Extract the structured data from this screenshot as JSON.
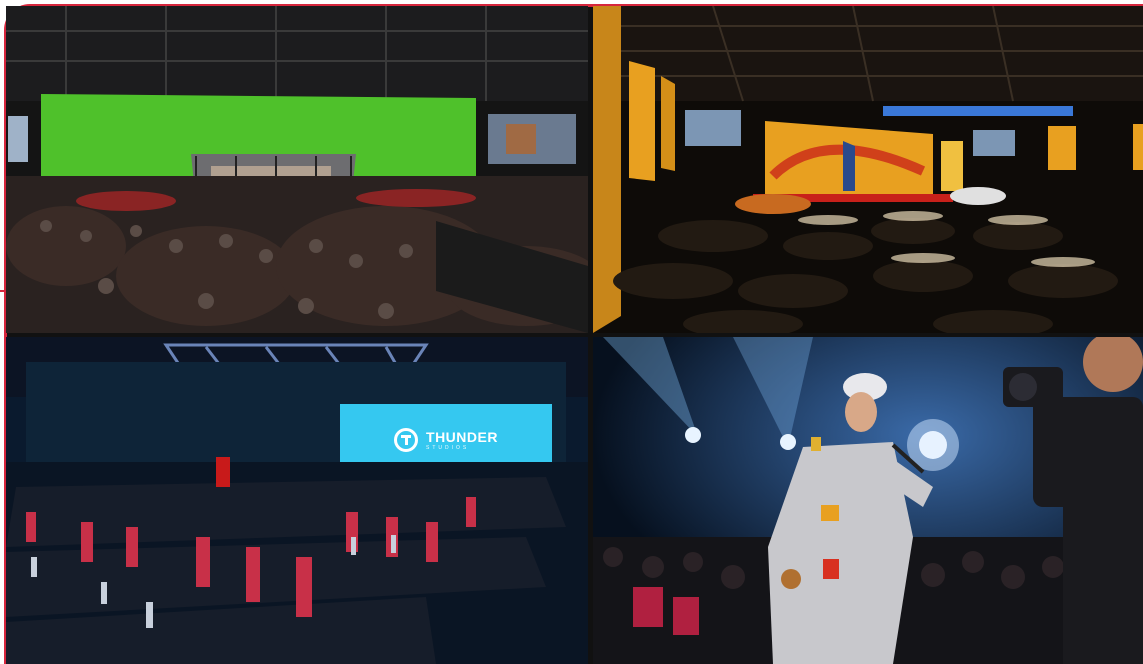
{
  "collage": {
    "panels": [
      {
        "name": "green-screen-fight-event"
      },
      {
        "name": "gala-dinner-hall"
      },
      {
        "name": "conference-seating-hall"
      },
      {
        "name": "live-performance-crowd"
      }
    ],
    "logo": {
      "name": "THUNDER",
      "sub": "STUDIOS"
    }
  },
  "colors": {
    "frame_border": "#d7263d",
    "screen_green": "#4fc12b",
    "led_wall_blue": "#35c8f0",
    "gala_gold": "#e8a020"
  }
}
